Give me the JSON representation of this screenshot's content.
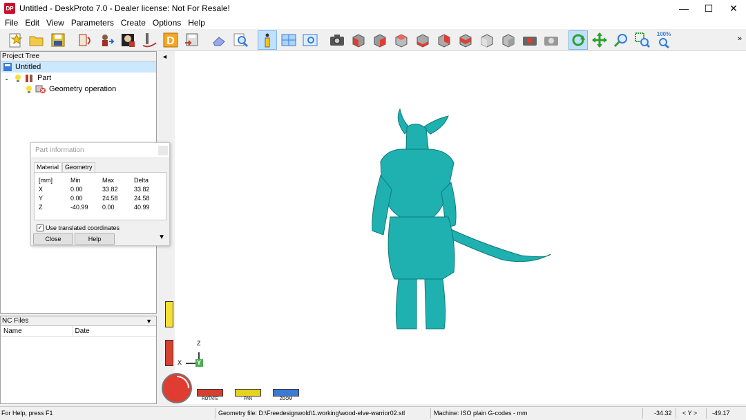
{
  "window": {
    "title": "Untitled - DeskProto 7.0 - Dealer license: Not For Resale!",
    "logo_text": "DP",
    "minimize": "—",
    "maximize": "☐",
    "close": "✕"
  },
  "menu": [
    "File",
    "Edit",
    "View",
    "Parameters",
    "Create",
    "Options",
    "Help"
  ],
  "toolbar": {
    "buttons": [
      "new-project",
      "open-project",
      "save-project",
      "rotate-part",
      "move-part",
      "scale-part",
      "cut-part",
      "design-mode",
      "save-geometry",
      "eraser",
      "zoom-search",
      "info",
      "windows",
      "screen",
      "camera",
      "view-front",
      "view-back",
      "view-left",
      "view-right",
      "view-top",
      "view-bottom",
      "view-iso-1",
      "view-iso-2",
      "render-options",
      "print",
      "rotate-tool",
      "pan-tool",
      "zoom-tool",
      "zoom-window"
    ],
    "zoom_label": "100%",
    "overflow": "»"
  },
  "project_tree": {
    "header": "Project Tree",
    "items": [
      {
        "label": "Untitled",
        "level": 0,
        "selected": true
      },
      {
        "label": "Part",
        "level": 1,
        "selected": false
      },
      {
        "label": "Geometry operation",
        "level": 2,
        "selected": false
      }
    ]
  },
  "nc_files": {
    "header": "NC Files",
    "col_name": "Name",
    "col_date": "Date"
  },
  "part_info": {
    "title": "Part information",
    "tab_material": "Material",
    "tab_geometry": "Geometry",
    "headers": [
      "[mm]",
      "Min",
      "Max",
      "Delta"
    ],
    "rows": [
      [
        "X",
        "0.00",
        "33.82",
        "33.82"
      ],
      [
        "Y",
        "0.00",
        "24.58",
        "24.58"
      ],
      [
        "Z",
        "-40.99",
        "0.00",
        "40.99"
      ]
    ],
    "checkbox_label": "Use translated coordinates",
    "checkbox_checked": true,
    "close_button": "Close",
    "help_button": "Help"
  },
  "viewport": {
    "axis_x": "X",
    "axis_y": "Y",
    "axis_z": "Z",
    "collapse": "◄",
    "mouse_rotate": "ROTATE",
    "mouse_pan": "PAN",
    "mouse_zoom": "ZOOM",
    "model_color": "#20b2b2"
  },
  "status": {
    "help": "For Help, press F1",
    "geometry": "Geometry file: D:\\Freedesignwold\\1.working\\wood-elve-warrior02.stl",
    "machine": "Machine: ISO plain G-codes - mm",
    "coord_x": "-34.32",
    "coord_label": "< Y >",
    "coord_y": "-49.17"
  }
}
